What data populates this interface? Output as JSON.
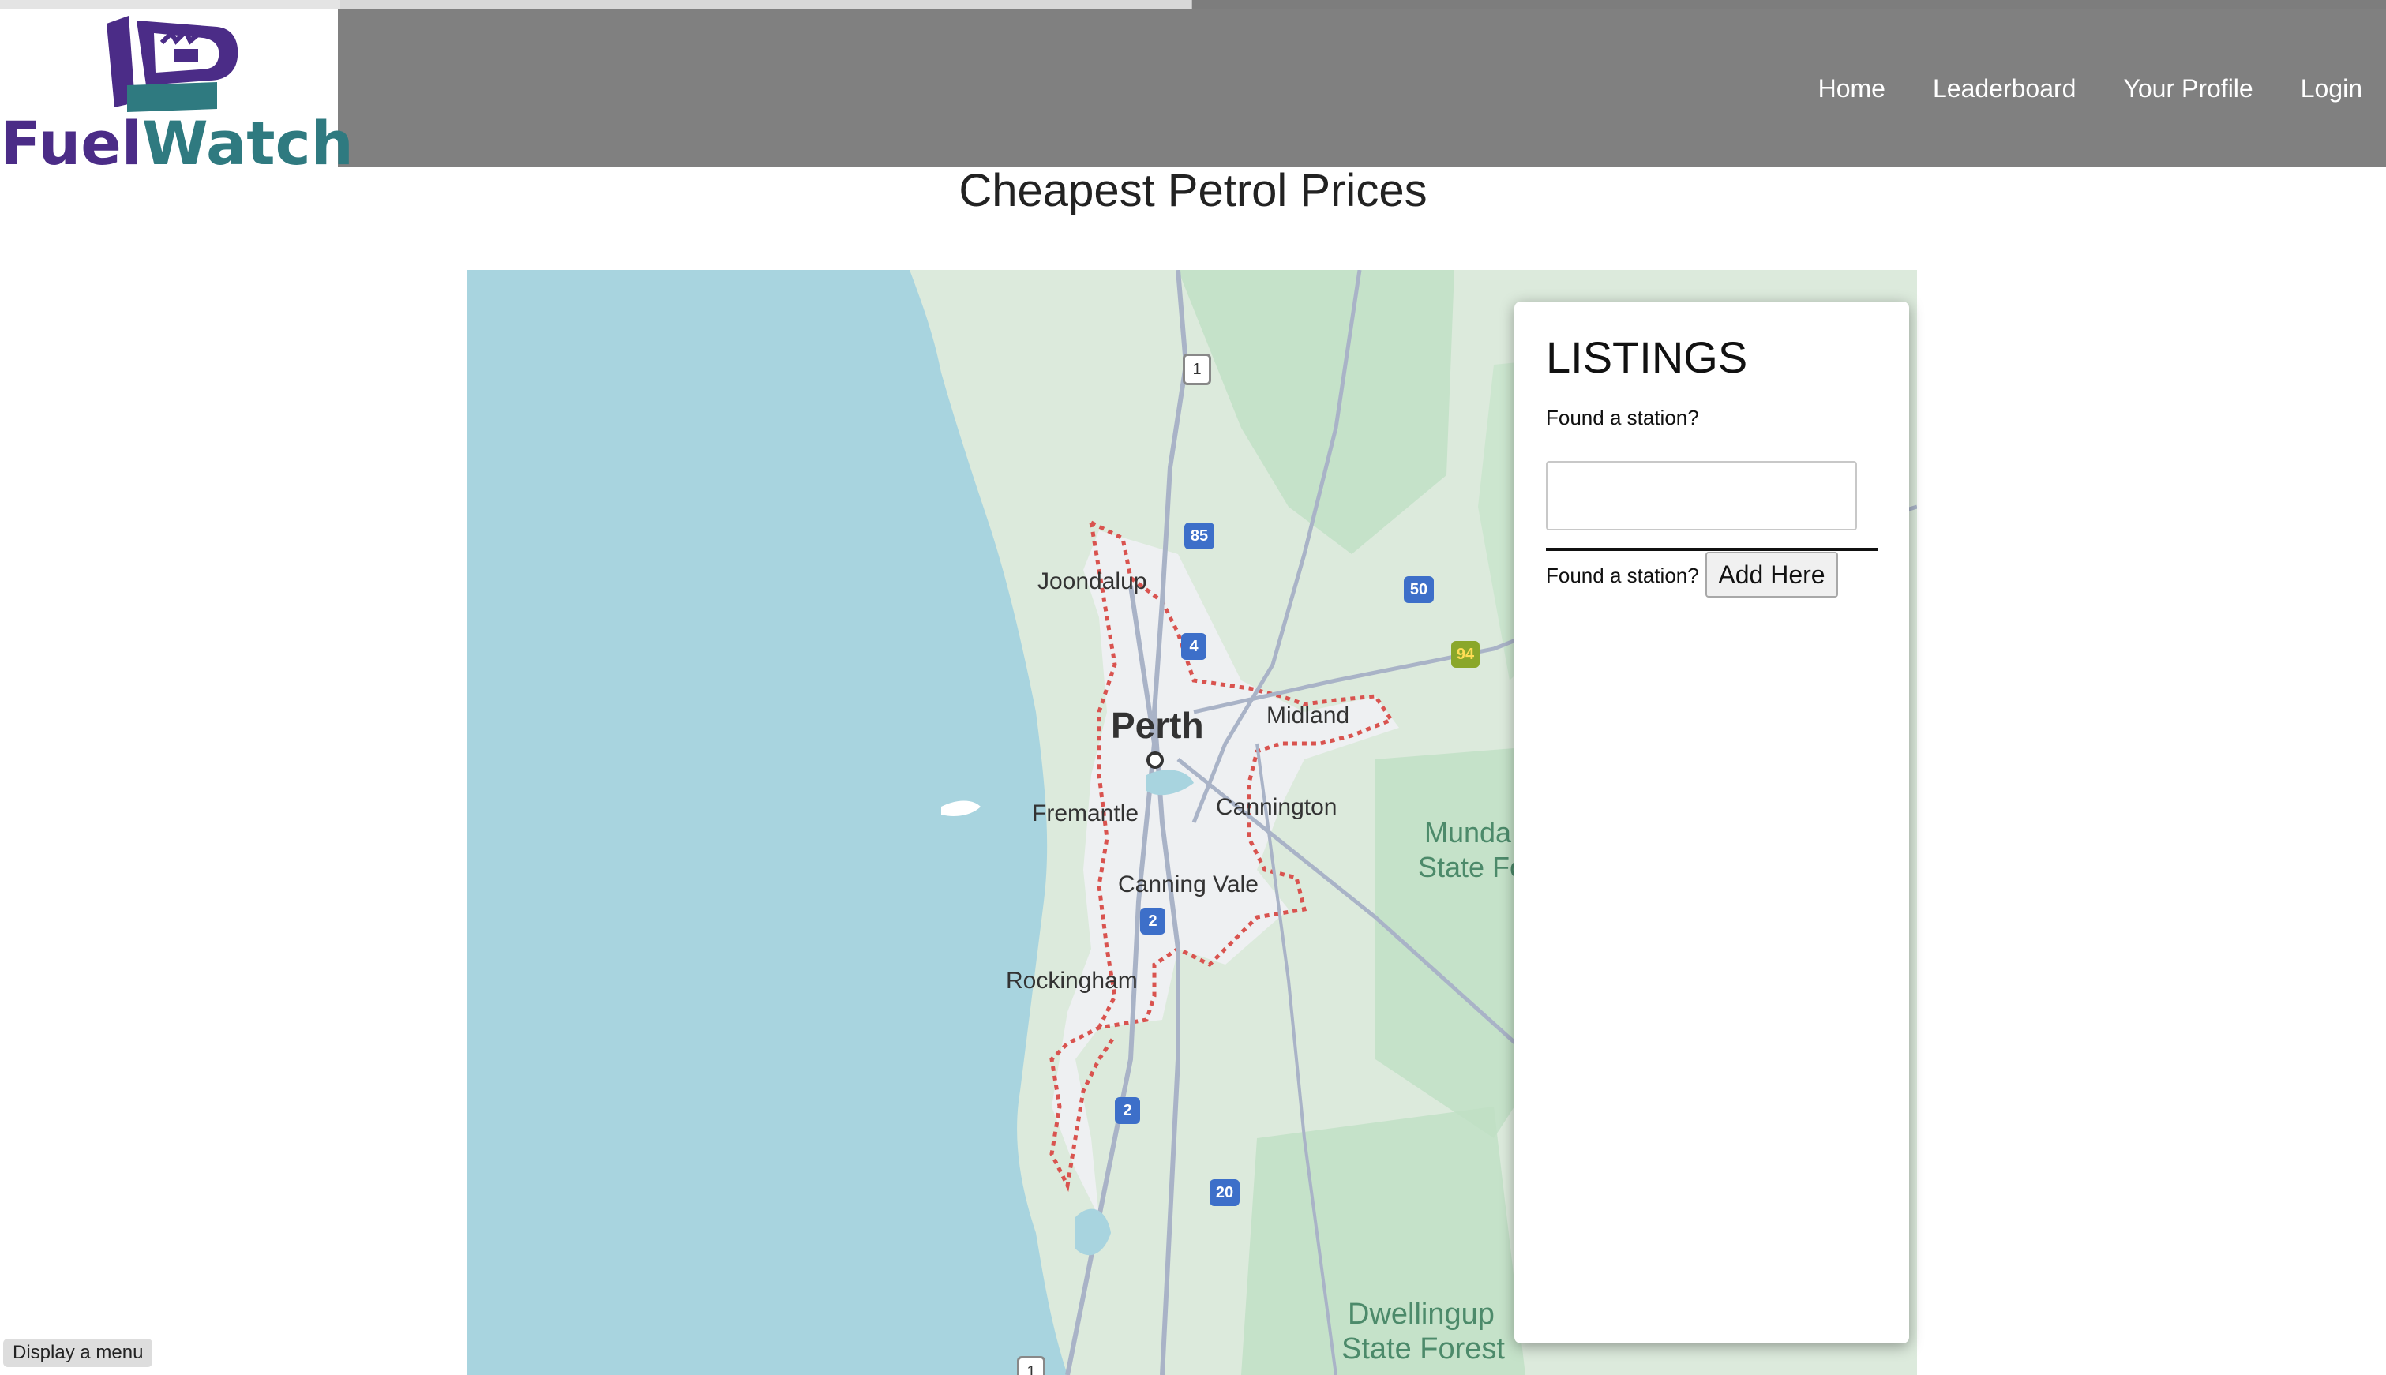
{
  "app": {
    "logo_part1": "Fuel",
    "logo_part2": "Watch"
  },
  "nav": {
    "home": "Home",
    "leaderboard": "Leaderboard",
    "profile": "Your Profile",
    "login": "Login"
  },
  "page": {
    "title": "Cheapest Petrol Prices"
  },
  "map": {
    "places": {
      "joondalup": "Joondalup",
      "perth": "Perth",
      "midland": "Midland",
      "fremantle": "Fremantle",
      "cannington": "Cannington",
      "canning_vale": "Canning Vale",
      "rockingham": "Rockingham",
      "munda": "Munda",
      "state_f": "State Fo",
      "dwellingup": "Dwellingup",
      "state_forest": "State Forest"
    },
    "routes": {
      "r1": "1",
      "r85": "85",
      "r50": "50",
      "r4": "4",
      "r94": "94",
      "r2a": "2",
      "r2b": "2",
      "r20": "20",
      "r1b": "1"
    }
  },
  "listings": {
    "title": "LISTINGS",
    "prompt1": "Found a station?",
    "input_value": "",
    "prompt2": "Found a station?",
    "add_button": "Add Here"
  },
  "footer": {
    "display_menu": "Display a menu"
  },
  "colors": {
    "nav_bg": "#808080",
    "logo_purple": "#4b2c87",
    "logo_teal": "#2f7a80",
    "water": "#a8d4df",
    "land": "#d9ead8",
    "urban_boundary": "#d9534f"
  }
}
